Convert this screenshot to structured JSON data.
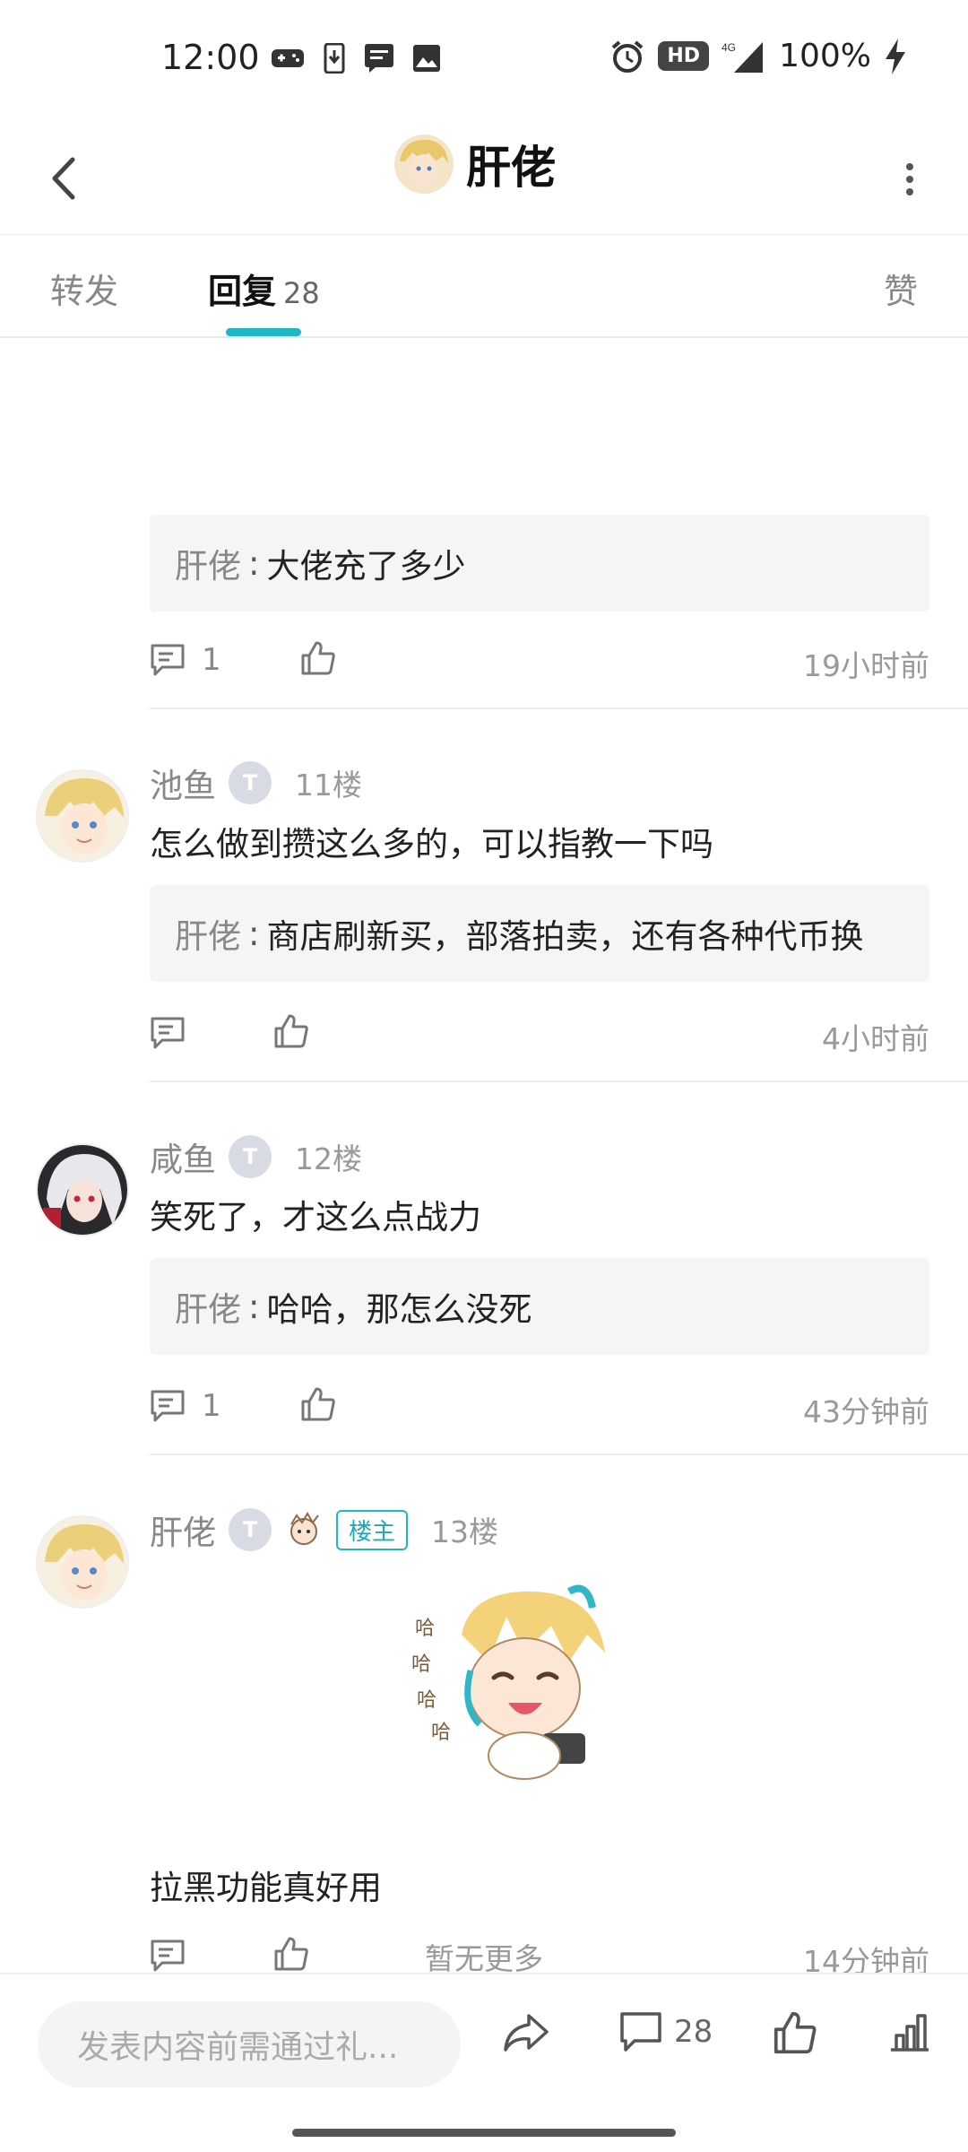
{
  "status_bar": {
    "time": "12:00",
    "battery": "100%",
    "hd_label": "HD",
    "network": "4G"
  },
  "header": {
    "title": "肝佬"
  },
  "tabs": {
    "forward": "转发",
    "reply": "回复",
    "reply_count": "28",
    "like": "赞"
  },
  "feed": {
    "first_block": {
      "reply": {
        "author": "肝佬",
        "separator": ":",
        "text": "大佬充了多少"
      },
      "comment_count": "1",
      "time": "19小时前"
    },
    "comments": [
      {
        "name": "池鱼",
        "level": "T",
        "floor": "11楼",
        "text": "怎么做到攒这么多的，可以指教一下吗",
        "reply": {
          "author": "肝佬",
          "separator": ":",
          "text": "商店刷新买，部落拍卖，还有各种代币换"
        },
        "comment_count": "",
        "time": "4小时前"
      },
      {
        "name": "咸鱼",
        "level": "T",
        "floor": "12楼",
        "text": "笑死了，才这么点战力",
        "reply": {
          "author": "肝佬",
          "separator": ":",
          "text": "哈哈，那怎么没死"
        },
        "comment_count": "1",
        "time": "43分钟前"
      },
      {
        "name": "肝佬",
        "level": "T",
        "owner_badge": "楼主",
        "floor": "13楼",
        "text": "拉黑功能真好用",
        "comment_count": "",
        "time": "14分钟前"
      }
    ],
    "end_text": "暂无更多"
  },
  "bottom_bar": {
    "input_placeholder": "发表内容前需通过礼...",
    "comment_count": "28"
  },
  "colors": {
    "accent": "#1fb7c5",
    "muted_text": "#888888",
    "reply_bg": "#f5f5f5"
  }
}
